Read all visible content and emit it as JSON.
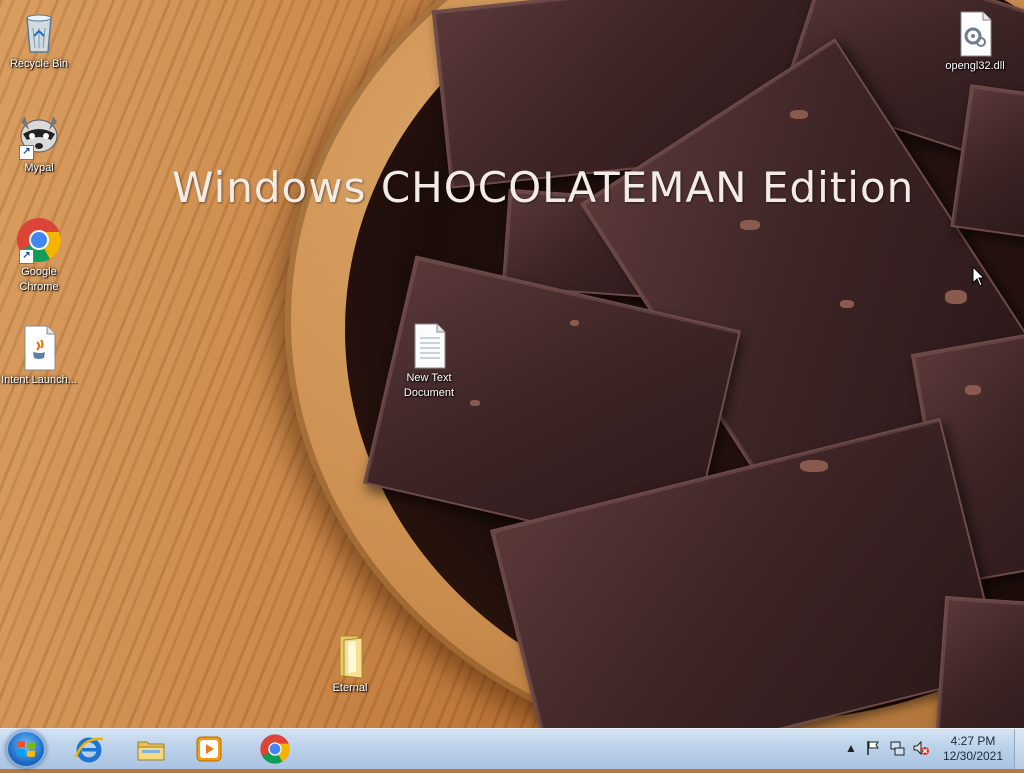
{
  "desktop": {
    "title": "Windows CHOCOLATEMAN Edition",
    "icons": [
      {
        "label": "Recycle Bin",
        "icon": "recycle-bin-icon"
      },
      {
        "label": "Mypal",
        "icon": "mypal-raccoon-icon"
      },
      {
        "label": "Google Chrome",
        "icon": "chrome-icon"
      },
      {
        "label": "Intent Launch...",
        "icon": "java-file-icon"
      },
      {
        "label": "New Text Document",
        "icon": "text-document-icon"
      },
      {
        "label": "Eternal",
        "icon": "folder-icon"
      },
      {
        "label": "opengl32.dll",
        "icon": "dll-file-icon"
      }
    ]
  },
  "taskbar": {
    "start_icon": "windows-start-orb",
    "pinned": [
      {
        "name": "Internet Explorer",
        "icon": "internet-explorer-icon"
      },
      {
        "name": "Windows Explorer",
        "icon": "file-explorer-icon"
      },
      {
        "name": "Windows Media Player",
        "icon": "media-player-icon"
      },
      {
        "name": "Google Chrome",
        "icon": "chrome-icon"
      }
    ],
    "tray": {
      "icons": [
        "show-hidden-icons-arrow",
        "action-center-flag-icon",
        "network-icon",
        "volume-muted-icon"
      ],
      "time": "4:27 PM",
      "date": "12/30/2021"
    }
  },
  "colors": {
    "taskbar_top": "#d4e3f3",
    "taskbar_bottom": "#a9c3e1",
    "title_text": "#f3ece6"
  }
}
